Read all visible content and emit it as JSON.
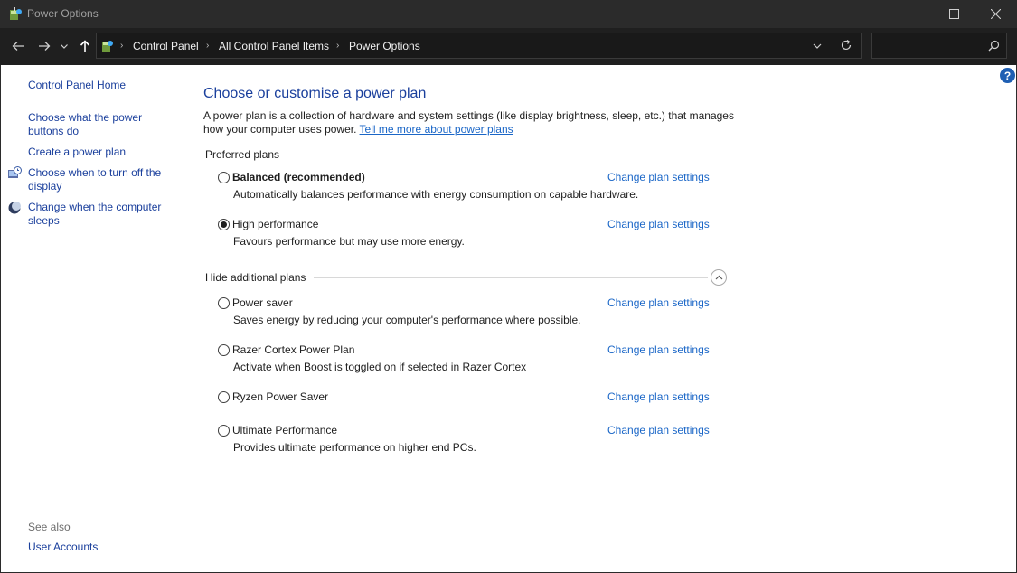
{
  "window": {
    "title": "Power Options",
    "controls": {
      "minimize": "minimize-icon",
      "maximize": "maximize-icon",
      "close": "close-icon"
    }
  },
  "address": {
    "breadcrumbs": [
      "Control Panel",
      "All Control Panel Items",
      "Power Options"
    ],
    "search_placeholder": ""
  },
  "sidebar": {
    "home": "Control Panel Home",
    "links": [
      "Choose what the power buttons do",
      "Create a power plan",
      "Choose when to turn off the display",
      "Change when the computer sleeps"
    ],
    "see_also_label": "See also",
    "see_also_links": [
      "User Accounts"
    ]
  },
  "main": {
    "title": "Choose or customise a power plan",
    "intro_text": "A power plan is a collection of hardware and system settings (like display brightness, sleep, etc.) that manages how your computer uses power.",
    "intro_link": "Tell me more about power plans",
    "preferred_heading": "Preferred plans",
    "additional_heading": "Hide additional plans",
    "change_link": "Change plan settings",
    "preferred_plans": [
      {
        "name": "Balanced (recommended)",
        "description": "Automatically balances performance with energy consumption on capable hardware.",
        "selected": false
      },
      {
        "name": "High performance",
        "description": "Favours performance but may use more energy.",
        "selected": true
      }
    ],
    "additional_plans": [
      {
        "name": "Power saver",
        "description": "Saves energy by reducing your computer's performance where possible.",
        "selected": false
      },
      {
        "name": "Razer Cortex Power Plan",
        "description": "Activate when Boost is toggled on if selected in Razer Cortex",
        "selected": false
      },
      {
        "name": "Ryzen Power Saver",
        "description": "",
        "selected": false
      },
      {
        "name": "Ultimate Performance",
        "description": "Provides ultimate performance on higher end PCs.",
        "selected": false
      }
    ]
  },
  "colors": {
    "link": "#1a66c7",
    "heading": "#1a3f9c",
    "titlebar": "#2b2b2b",
    "navbar": "#1f1f1f"
  }
}
